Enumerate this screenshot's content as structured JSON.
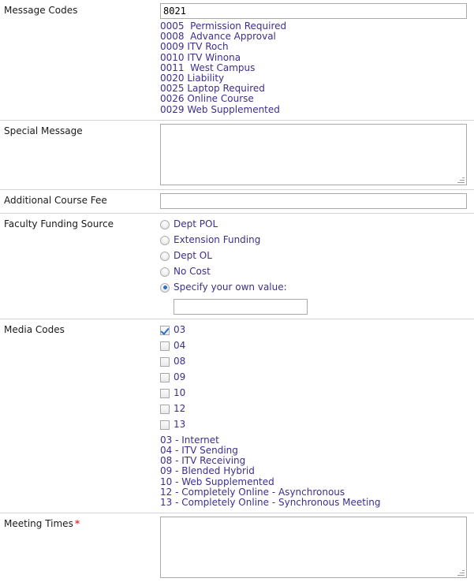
{
  "colors": {
    "link_text": "#3b2f8f",
    "label_text": "#1a1a1a",
    "required_marker": "#e33b3b",
    "control_border": "#a9a9a9",
    "row_divider": "#d3d3d3",
    "selected_accent": "#2a6fc9"
  },
  "rows": {
    "message_codes": {
      "label": "Message Codes",
      "value": "8021",
      "placeholder": "",
      "codes": [
        "0005  Permission Required",
        "0008  Advance Approval",
        "0009 ITV Roch",
        "0010 ITV Winona",
        "0011  West Campus",
        "0020 Liability",
        "0025 Laptop Required",
        "0026 Online Course",
        "0029 Web Supplemented"
      ]
    },
    "special_message": {
      "label": "Special Message",
      "value": "",
      "placeholder": ""
    },
    "additional_course_fee": {
      "label": "Additional Course Fee",
      "value": "",
      "placeholder": ""
    },
    "faculty_funding_source": {
      "label": "Faculty Funding Source",
      "options": [
        {
          "label": "Dept POL",
          "selected": false
        },
        {
          "label": "Extension Funding",
          "selected": false
        },
        {
          "label": "Dept OL",
          "selected": false
        },
        {
          "label": "No Cost",
          "selected": false
        },
        {
          "label": "Specify your own value:",
          "selected": true
        }
      ],
      "own_value": "",
      "own_value_placeholder": ""
    },
    "media_codes": {
      "label": "Media Codes",
      "options": [
        {
          "label": "03",
          "checked": true
        },
        {
          "label": "04",
          "checked": false
        },
        {
          "label": "08",
          "checked": false
        },
        {
          "label": "09",
          "checked": false
        },
        {
          "label": "10",
          "checked": false
        },
        {
          "label": "12",
          "checked": false
        },
        {
          "label": "13",
          "checked": false
        }
      ],
      "legend": [
        "03 - Internet",
        "04 - ITV Sending",
        "08 - ITV Receiving",
        "09 - Blended Hybrid",
        "10 - Web Supplemented",
        "12 - Completely Online - Asynchronous",
        "13 - Completely Online - Synchronous Meeting"
      ]
    },
    "meeting_times": {
      "label": "Meeting Times",
      "required_marker": "*",
      "value": "",
      "placeholder": ""
    }
  }
}
